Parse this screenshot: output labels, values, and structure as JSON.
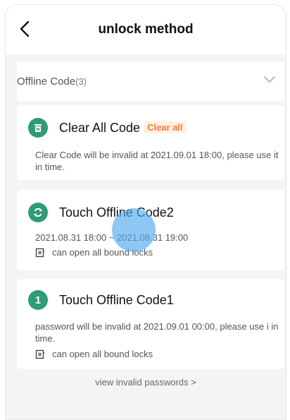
{
  "header": {
    "title": "unlock method"
  },
  "section": {
    "label": "Offline Code",
    "count": "(3)"
  },
  "cards": [
    {
      "title": "Clear All Code",
      "tag": "Clear all",
      "desc": "Clear Code will be invalid at 2021.09.01 18:00, please use it in time."
    },
    {
      "title": "Touch Offline Code2",
      "validity": "2021.08.31 18:00 ~ 2021.08.31 19:00",
      "scope": "can open all bound locks"
    },
    {
      "title": "Touch Offline Code1",
      "badge": "1",
      "desc": "password will be invalid at 2021.09.01 00:00, please use i in time.",
      "scope": "can open all bound locks"
    }
  ],
  "footer": {
    "link": "view invalid passwords >"
  },
  "colors": {
    "accent": "#2f9b78",
    "tag": "#ff7a2a",
    "touch": "#50aaf0"
  },
  "icons": [
    "back-arrow-icon",
    "chevron-down-icon",
    "trash-icon",
    "refresh-icon",
    "lock-outline-icon"
  ]
}
